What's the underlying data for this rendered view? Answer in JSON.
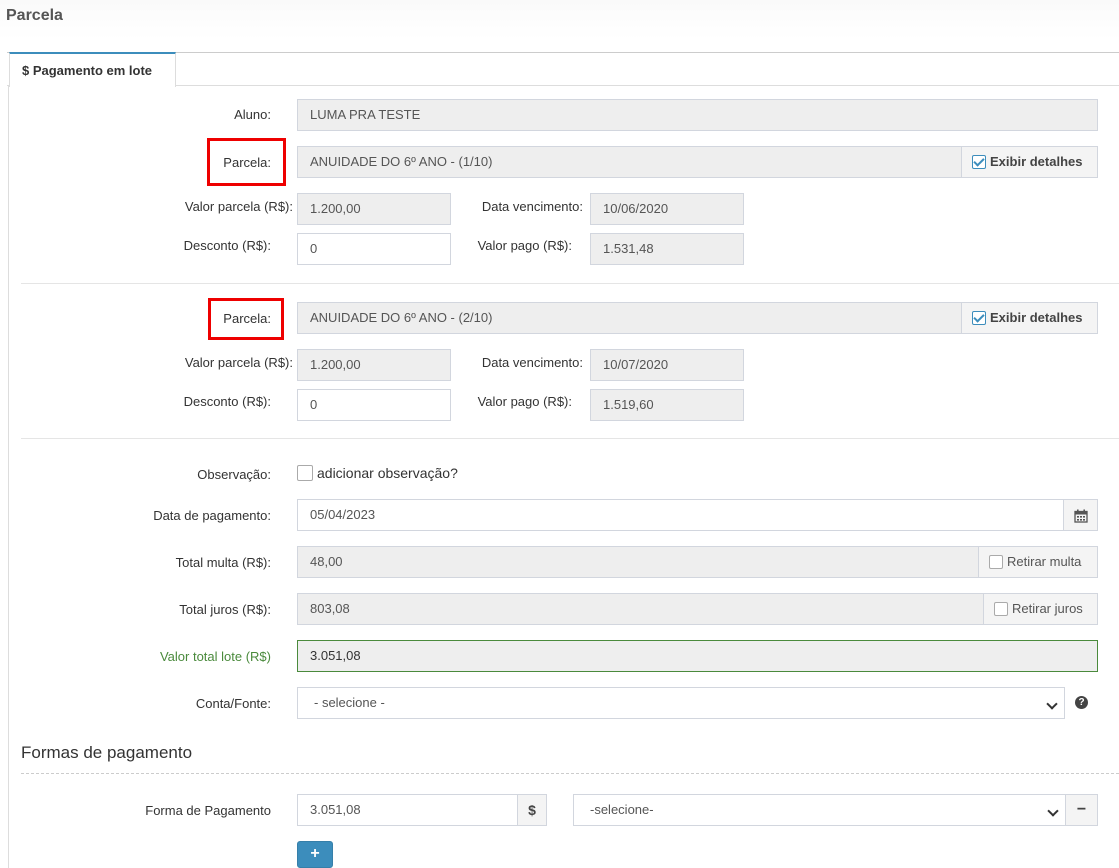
{
  "page": {
    "title": "Parcela"
  },
  "tab": {
    "label": "$ Pagamento em lote"
  },
  "aluno": {
    "label": "Aluno:",
    "value": "LUMA PRA TESTE"
  },
  "parcelas": [
    {
      "parcela_label": "Parcela:",
      "parcela_value": "ANUIDADE DO 6º ANO - (1/10)",
      "detalhes_label": "Exibir detalhes",
      "detalhes_checked": true,
      "valor_parcela_label": "Valor parcela (R$):",
      "valor_parcela": "1.200,00",
      "data_vencimento_label": "Data vencimento:",
      "data_vencimento": "10/06/2020",
      "desconto_label": "Desconto (R$):",
      "desconto": "0",
      "valor_pago_label": "Valor pago (R$):",
      "valor_pago": "1.531,48"
    },
    {
      "parcela_label": "Parcela:",
      "parcela_value": "ANUIDADE DO 6º ANO - (2/10)",
      "detalhes_label": "Exibir detalhes",
      "detalhes_checked": true,
      "valor_parcela_label": "Valor parcela (R$):",
      "valor_parcela": "1.200,00",
      "data_vencimento_label": "Data vencimento:",
      "data_vencimento": "10/07/2020",
      "desconto_label": "Desconto (R$):",
      "desconto": "0",
      "valor_pago_label": "Valor pago (R$):",
      "valor_pago": "1.519,60"
    }
  ],
  "observacao": {
    "label": "Observação:",
    "checkbox_label": "adicionar observação?"
  },
  "data_pagamento": {
    "label": "Data de pagamento:",
    "value": "05/04/2023",
    "icon": "calendar-icon"
  },
  "total_multa": {
    "label": "Total multa (R$):",
    "value": "48,00",
    "checkbox_label": "Retirar multa"
  },
  "total_juros": {
    "label": "Total juros (R$):",
    "value": "803,08",
    "checkbox_label": "Retirar juros"
  },
  "valor_total": {
    "label": "Valor total lote (R$)",
    "value": "3.051,08"
  },
  "conta_fonte": {
    "label": "Conta/Fonte:",
    "selected": "- selecione -",
    "help_icon": "help-icon"
  },
  "formas": {
    "title": "Formas de pagamento",
    "forma_label": "Forma de Pagamento",
    "valor": "3.051,08",
    "currency_symbol": "$",
    "selected": "-selecione-",
    "remove_symbol": "−",
    "add_symbol": "+"
  },
  "colors": {
    "accent": "#3c8dbc",
    "highlight_red": "#e00000",
    "success_green": "#4a8a3c"
  }
}
